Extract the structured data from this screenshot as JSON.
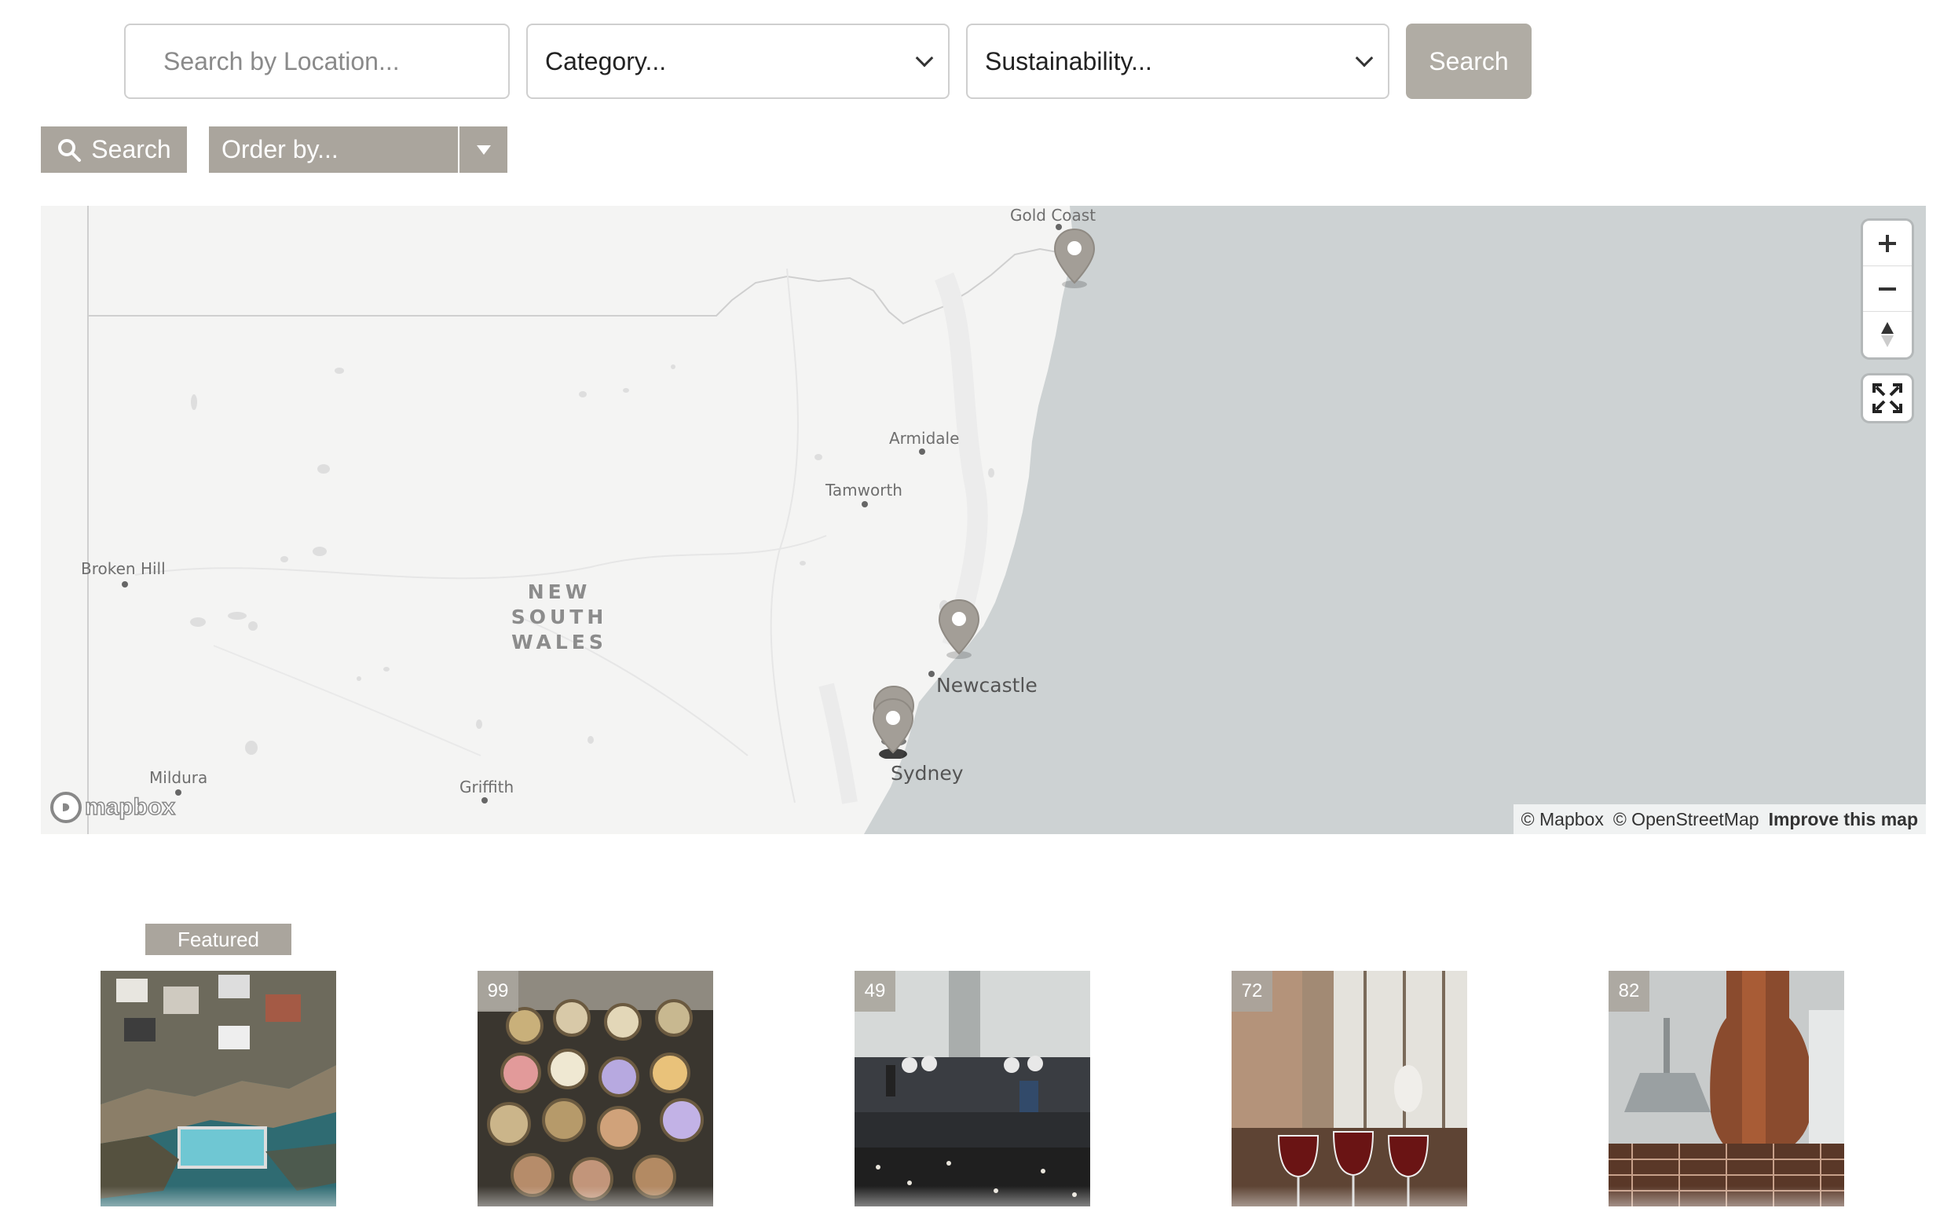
{
  "filters": {
    "location_placeholder": "Search by Location...",
    "category_value": "Category...",
    "sustainability_value": "Sustainability...",
    "search_label": "Search"
  },
  "toolbar": {
    "search_label": "Search",
    "order_value": "Order by..."
  },
  "map": {
    "labels": {
      "gold_coast": "Gold Coast",
      "armidale": "Armidale",
      "tamworth": "Tamworth",
      "broken_hill": "Broken Hill",
      "state_line1": "NEW SOUTH",
      "state_line2": "WALES",
      "newcastle": "Newcastle",
      "sydney": "Sydney",
      "mildura": "Mildura",
      "griffith": "Griffith"
    },
    "attribution": {
      "mapbox": "© Mapbox",
      "osm": "© OpenStreetMap",
      "improve": "Improve this map"
    },
    "logo_text": "mapbox",
    "controls": [
      "zoom-in",
      "zoom-out",
      "compass",
      "fullscreen"
    ],
    "colors": {
      "land": "#f4f4f3",
      "water": "#cdd2d3",
      "pin": "#a39e97"
    }
  },
  "listings": {
    "featured_label": "Featured",
    "items": [
      {
        "badge": ""
      },
      {
        "badge": "99"
      },
      {
        "badge": "49"
      },
      {
        "badge": "72"
      },
      {
        "badge": "82"
      }
    ]
  }
}
